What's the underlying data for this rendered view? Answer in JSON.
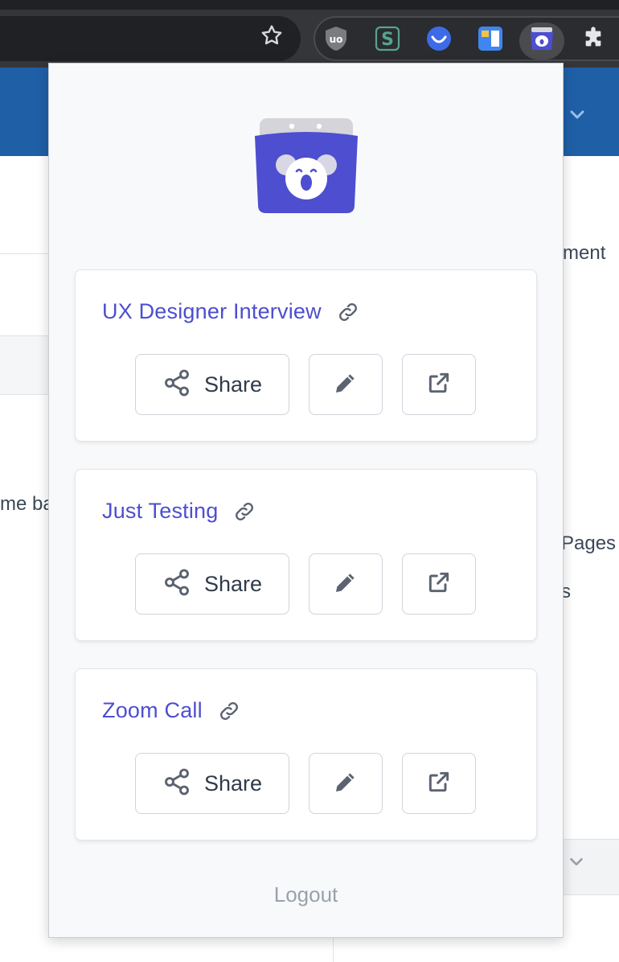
{
  "browser": {
    "extensions": [
      "ublock-origin-icon",
      "s-extension-icon",
      "smile-extension-icon",
      "blue-yellow-extension-icon",
      "koala-extension-icon",
      "puzzle-icon"
    ]
  },
  "background_page": {
    "text_right_1": "ment",
    "text_left_1": "me ba",
    "text_right_2": "Pages",
    "text_right_3": "s"
  },
  "popup": {
    "logo_icon": "koala-logo-icon",
    "cards": [
      {
        "title": "UX Designer Interview",
        "share_label": "Share"
      },
      {
        "title": "Just Testing",
        "share_label": "Share"
      },
      {
        "title": "Zoom Call",
        "share_label": "Share"
      }
    ],
    "logout_label": "Logout"
  },
  "colors": {
    "accent": "#4d4ed0",
    "header_blue": "#1f5fa6",
    "browser_dark": "#35363a"
  }
}
